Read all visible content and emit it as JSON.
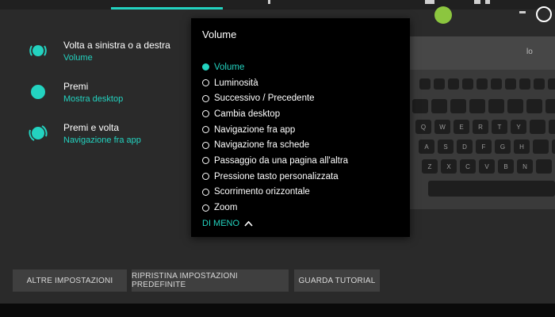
{
  "colors": {
    "accent": "#23d3c0",
    "background": "#2a2a2a",
    "dropdown_bg": "#000000",
    "button_bg": "#3f3f3f"
  },
  "actions": [
    {
      "title": "Volta a sinistra o a destra",
      "value": "Volume",
      "icon": "rotate-icon"
    },
    {
      "title": "Premi",
      "value": "Mostra desktop",
      "icon": "press-icon"
    },
    {
      "title": "Premi e volta",
      "value": "Navigazione fra app",
      "icon": "press-rotate-icon"
    }
  ],
  "dropdown": {
    "header": "Volume",
    "selected": "Volume",
    "options": [
      "Volume",
      "Luminosità",
      "Successivo / Precedente",
      "Cambia desktop",
      "Navigazione fra app",
      "Navigazione fra schede",
      "Passaggio da una pagina all'altra",
      "Pressione tasto personalizzata",
      "Scorrimento orizzontale",
      "Zoom"
    ],
    "less_label": "DI MENO"
  },
  "keyboard": {
    "logo": "lo",
    "row2": [
      "Q",
      "W",
      "E",
      "R",
      "T",
      "Y"
    ],
    "row3": [
      "A",
      "S",
      "D",
      "F",
      "G",
      "H"
    ],
    "row4": [
      "Z",
      "X",
      "C",
      "V",
      "B",
      "N"
    ]
  },
  "buttons": {
    "more_settings": "ALTRE IMPOSTAZIONI",
    "restore_defaults": "RIPRISTINA IMPOSTAZIONI PREDEFINITE",
    "watch_tutorial": "GUARDA TUTORIAL"
  }
}
